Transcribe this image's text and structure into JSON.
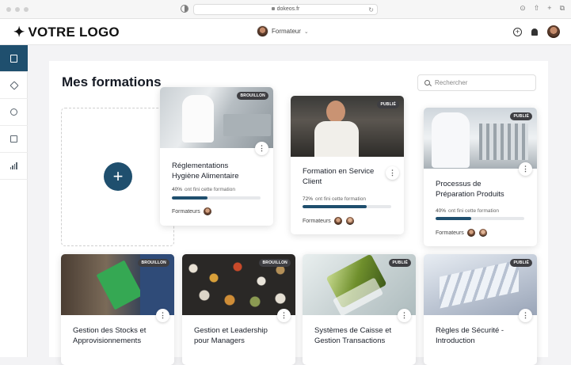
{
  "browser": {
    "url": "dokeos.fr"
  },
  "header": {
    "logo_text": "VOTRE LOGO",
    "logo_symbol": "✦",
    "role_label": "Formateur"
  },
  "sidebar": {
    "items": [
      {
        "name": "book-icon",
        "active": true
      },
      {
        "name": "cube-icon",
        "active": false
      },
      {
        "name": "route-icon",
        "active": false
      },
      {
        "name": "stack-icon",
        "active": false
      },
      {
        "name": "bar-chart-icon",
        "active": false
      }
    ]
  },
  "main": {
    "title": "Mes formations",
    "search_placeholder": "Rechercher",
    "add_symbol": "+"
  },
  "progress_suffix": "ont fini cette formation",
  "trainers_label": "Formateurs",
  "kebab_symbol": "⋮",
  "cards": [
    {
      "title_line1": "Réglementations",
      "title_line2": "Hygiène Alimentaire",
      "status": "BROUILLON",
      "progress_label": "40%",
      "progress": 0.4,
      "trainer_count": 1
    },
    {
      "title_line1": "Formation en Service",
      "title_line2": "Client",
      "status": "PUBLIÉ",
      "progress_label": "72%",
      "progress": 0.72,
      "trainer_count": 2
    },
    {
      "title_line1": "Processus de",
      "title_line2": "Préparation Produits",
      "status": "PUBLIÉ",
      "progress_label": "40%",
      "progress": 0.4,
      "trainer_count": 2
    },
    {
      "title_line1": "Gestion des Stocks et",
      "title_line2": "Approvisionnements",
      "status": "BROUILLON"
    },
    {
      "title_line1": "Gestion et Leadership",
      "title_line2": "pour Managers",
      "status": "BROUILLON"
    },
    {
      "title_line1": "Systèmes de Caisse et",
      "title_line2": "Gestion Transactions",
      "status": "PUBLIÉ"
    },
    {
      "title_line1": "Règles de Sécurité -",
      "title_line2": "Introduction",
      "status": "PUBLIÉ"
    }
  ],
  "colors": {
    "accent": "#1f4f6e",
    "badge": "#3e3e42",
    "progress_track": "#e6e8eb"
  }
}
